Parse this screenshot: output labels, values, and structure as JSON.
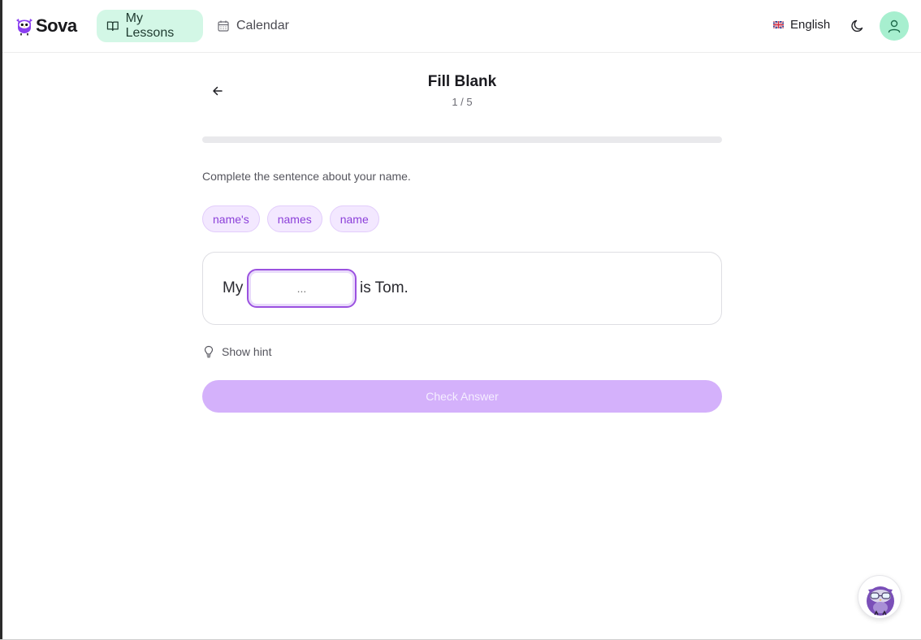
{
  "brand": {
    "name": "Sova",
    "accent": "#9b51e0"
  },
  "nav": [
    {
      "label": "My Lessons",
      "icon": "book-open-icon",
      "active": true
    },
    {
      "label": "Calendar",
      "icon": "calendar-icon",
      "active": false
    }
  ],
  "header": {
    "language": "English",
    "language_flag": "uk-flag-icon",
    "theme_toggle_icon": "moon-icon",
    "avatar_icon": "user-icon"
  },
  "exercise": {
    "title": "Fill Blank",
    "counter": "1 / 5",
    "progress": 0,
    "instruction": "Complete the sentence about your name.",
    "options": [
      "name's",
      "names",
      "name"
    ],
    "sentence_before": "My",
    "sentence_after": "is Tom.",
    "blank_placeholder": "...",
    "hint_label": "Show hint",
    "check_label": "Check Answer"
  },
  "assistant": {
    "icon": "owl-mascot-icon"
  }
}
